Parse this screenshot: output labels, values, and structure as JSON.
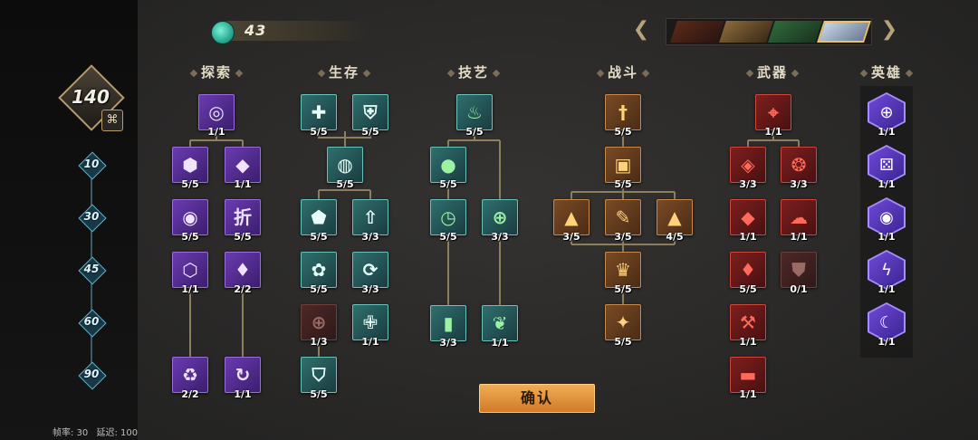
{
  "currency": {
    "value": "43",
    "icon": "gem-icon"
  },
  "level": {
    "value": "140",
    "icon": "emblem-icon"
  },
  "milestones": [
    "10",
    "30",
    "45",
    "60",
    "90"
  ],
  "stats": {
    "fps_label": "帧率: 30",
    "latency_label": "延迟: 100"
  },
  "columns": {
    "explore": "探索",
    "survival": "生存",
    "craft": "技艺",
    "combat": "战斗",
    "weapon": "武器",
    "hero": "英雄"
  },
  "confirm_label": "确认",
  "nodes": {
    "explore": [
      {
        "count": "1/1",
        "icon": "swirl-icon"
      },
      {
        "count": "5/5",
        "icon": "coin-icon"
      },
      {
        "count": "1/1",
        "icon": "pouch-icon"
      },
      {
        "count": "5/5",
        "icon": "coins-stack-icon"
      },
      {
        "count": "5/5",
        "icon": "discount-icon",
        "glyph": "折"
      },
      {
        "count": "1/1",
        "icon": "coin-glow-icon"
      },
      {
        "count": "2/2",
        "icon": "crystal-icon"
      },
      {
        "count": "2/2",
        "icon": "recycle-icon"
      },
      {
        "count": "1/1",
        "icon": "refresh-icon"
      }
    ],
    "survival": [
      {
        "count": "5/5",
        "icon": "health-plus-icon"
      },
      {
        "count": "5/5",
        "icon": "armor-icon"
      },
      {
        "count": "5/5",
        "icon": "regen-orb-icon"
      },
      {
        "count": "5/5",
        "icon": "shield-icon"
      },
      {
        "count": "3/3",
        "icon": "upgrade-arrow-icon"
      },
      {
        "count": "5/5",
        "icon": "swirl-wind-icon"
      },
      {
        "count": "3/3",
        "icon": "recovery-icon"
      },
      {
        "count": "1/3",
        "icon": "medkit-icon"
      },
      {
        "count": "1/1",
        "icon": "heal-cross-icon"
      },
      {
        "count": "5/5",
        "icon": "cape-icon"
      }
    ],
    "craft": [
      {
        "count": "5/5",
        "icon": "flame-icon"
      },
      {
        "count": "5/5",
        "icon": "bomb-icon"
      },
      {
        "count": "5/5",
        "icon": "timer-icon"
      },
      {
        "count": "3/3",
        "icon": "heal-ring-icon"
      },
      {
        "count": "3/3",
        "icon": "scroll-icon"
      },
      {
        "count": "1/1",
        "icon": "leaves-icon"
      }
    ],
    "combat": [
      {
        "count": "5/5",
        "icon": "sword-icon"
      },
      {
        "count": "5/5",
        "icon": "chest-icon"
      },
      {
        "count": "3/5",
        "icon": "bullet-icon"
      },
      {
        "count": "3/5",
        "icon": "pencil-bullet-icon"
      },
      {
        "count": "4/5",
        "icon": "bullet-alt-icon"
      },
      {
        "count": "5/5",
        "icon": "crown-icon"
      },
      {
        "count": "5/5",
        "icon": "star-burst-icon"
      }
    ],
    "weapon": [
      {
        "count": "1/1",
        "icon": "crosshair-icon"
      },
      {
        "count": "3/3",
        "icon": "gem-shard-icon"
      },
      {
        "count": "3/3",
        "icon": "dragon-icon"
      },
      {
        "count": "1/1",
        "icon": "ruby-icon"
      },
      {
        "count": "1/1",
        "icon": "cloud-icon"
      },
      {
        "count": "5/5",
        "icon": "rank-gem-icon"
      },
      {
        "count": "0/1",
        "icon": "locked-shield-icon"
      },
      {
        "count": "1/1",
        "icon": "hammer-icon"
      },
      {
        "count": "1/1",
        "icon": "turret-icon"
      }
    ],
    "hero": [
      {
        "count": "1/1",
        "icon": "target-icon"
      },
      {
        "count": "1/1",
        "icon": "dice-icon"
      },
      {
        "count": "1/1",
        "icon": "vortex-icon"
      },
      {
        "count": "1/1",
        "icon": "lightning-icon"
      },
      {
        "count": "1/1",
        "icon": "crescent-icon"
      }
    ]
  }
}
